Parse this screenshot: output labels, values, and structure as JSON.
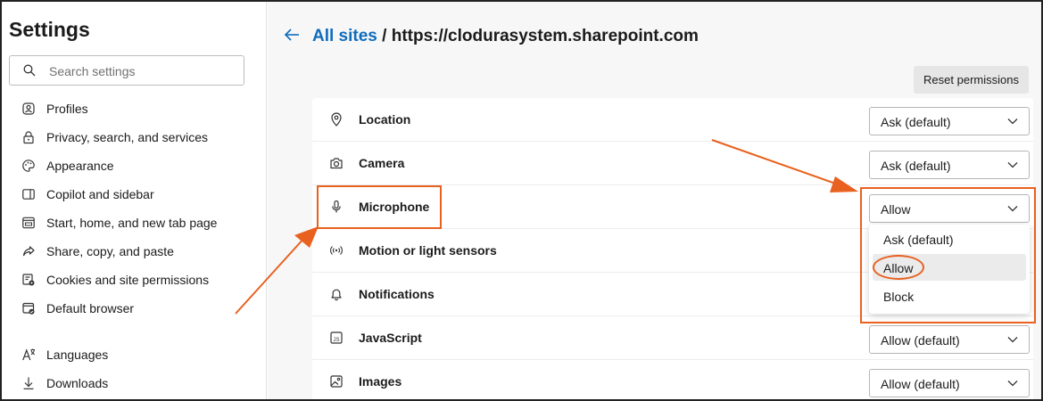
{
  "sidebar": {
    "title": "Settings",
    "search": {
      "placeholder": "Search settings",
      "value": ""
    },
    "items": [
      {
        "label": "Profiles",
        "icon": "profile-icon"
      },
      {
        "label": "Privacy, search, and services",
        "icon": "lock-icon"
      },
      {
        "label": "Appearance",
        "icon": "palette-icon"
      },
      {
        "label": "Copilot and sidebar",
        "icon": "sidebar-icon"
      },
      {
        "label": "Start, home, and new tab page",
        "icon": "home-tab-icon"
      },
      {
        "label": "Share, copy, and paste",
        "icon": "share-icon"
      },
      {
        "label": "Cookies and site permissions",
        "icon": "cookies-icon"
      },
      {
        "label": "Default browser",
        "icon": "browser-icon"
      },
      {
        "label": "Languages",
        "icon": "languages-icon"
      },
      {
        "label": "Downloads",
        "icon": "download-icon"
      }
    ]
  },
  "header": {
    "back_label": "All sites",
    "separator": " / ",
    "site": "https://clodurasystem.sharepoint.com"
  },
  "reset_label": "Reset permissions",
  "permissions": [
    {
      "label": "Location",
      "value": "Ask (default)",
      "icon": "location-icon"
    },
    {
      "label": "Camera",
      "value": "Ask (default)",
      "icon": "camera-icon"
    },
    {
      "label": "Microphone",
      "value": "Allow",
      "icon": "microphone-icon"
    },
    {
      "label": "Motion or light sensors",
      "value": "",
      "icon": "sensor-icon"
    },
    {
      "label": "Notifications",
      "value": "",
      "icon": "bell-icon"
    },
    {
      "label": "JavaScript",
      "value": "Allow (default)",
      "icon": "javascript-icon"
    },
    {
      "label": "Images",
      "value": "Allow (default)",
      "icon": "image-icon"
    }
  ],
  "dropdown": {
    "options": [
      "Ask (default)",
      "Allow",
      "Block"
    ],
    "selected": "Allow"
  },
  "colors": {
    "accent": "#0f6cbd",
    "annotation": "#e8611f"
  }
}
